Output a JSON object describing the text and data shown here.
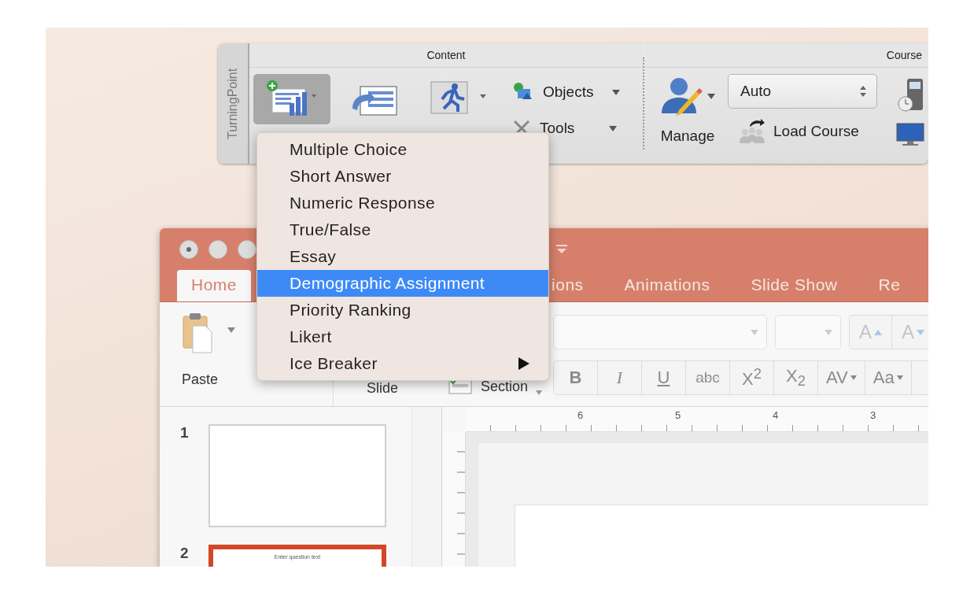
{
  "toolbar": {
    "side_tab": "TurningPoint",
    "content_label": "Content",
    "course_label": "Course",
    "new_selected": true,
    "objects": "Objects",
    "tools": "Tools",
    "manage": "Manage",
    "session_select": "Auto",
    "load_course": "Load Course"
  },
  "menu": {
    "items": [
      {
        "label": "Multiple Choice",
        "selected": false,
        "submenu": false
      },
      {
        "label": "Short Answer",
        "selected": false,
        "submenu": false
      },
      {
        "label": "Numeric Response",
        "selected": false,
        "submenu": false
      },
      {
        "label": "True/False",
        "selected": false,
        "submenu": false
      },
      {
        "label": "Essay",
        "selected": false,
        "submenu": false
      },
      {
        "label": "Demographic Assignment",
        "selected": true,
        "submenu": false
      },
      {
        "label": "Priority Ranking",
        "selected": false,
        "submenu": false
      },
      {
        "label": "Likert",
        "selected": false,
        "submenu": false
      },
      {
        "label": "Ice Breaker",
        "selected": false,
        "submenu": true
      }
    ]
  },
  "window": {
    "tabs": [
      {
        "label": "Home",
        "selected": true
      },
      {
        "label": "ions",
        "selected": false
      },
      {
        "label": "Animations",
        "selected": false
      },
      {
        "label": "Slide Show",
        "selected": false
      },
      {
        "label": "Re",
        "selected": false
      }
    ],
    "ribbon": {
      "paste": "Paste",
      "slide": "Slide",
      "section": "Section",
      "size_buttons": [
        {
          "label": "A",
          "kind": "grow"
        },
        {
          "label": "A",
          "kind": "shrink"
        }
      ],
      "format_buttons": [
        {
          "label": "B",
          "disabled": true,
          "dropdown": false
        },
        {
          "label": "I",
          "disabled": true,
          "dropdown": false
        },
        {
          "label": "U",
          "disabled": true,
          "dropdown": false
        },
        {
          "label": "abc",
          "disabled": true,
          "dropdown": false
        },
        {
          "label": "X$^{2}$",
          "disabled": true,
          "dropdown": false
        },
        {
          "label": "X$_{2}$",
          "disabled": true,
          "dropdown": false
        },
        {
          "label": "AV",
          "disabled": true,
          "dropdown": true
        },
        {
          "label": "Aa",
          "disabled": true,
          "dropdown": true
        }
      ]
    },
    "ruler": [
      "6",
      "5",
      "4",
      "3"
    ],
    "slides": [
      {
        "number": "1",
        "selected": false
      },
      {
        "number": "2",
        "selected": true,
        "text": "Enter question text"
      }
    ]
  }
}
